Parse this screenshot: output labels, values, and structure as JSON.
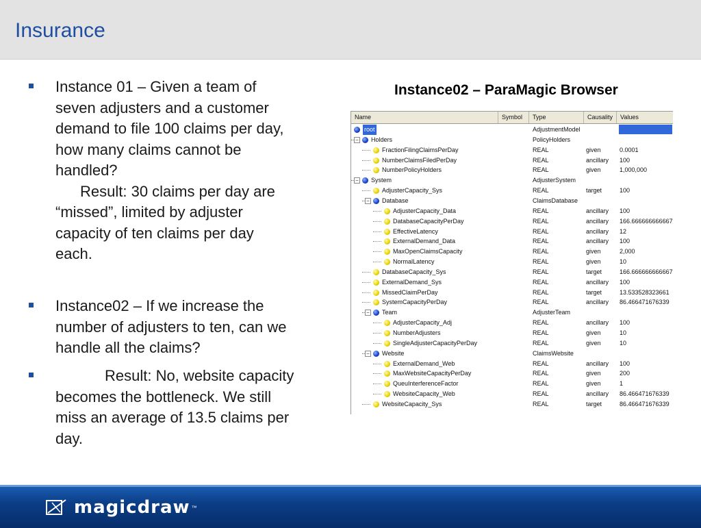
{
  "slide": {
    "title": "Insurance"
  },
  "bullets": [
    {
      "lines": [
        "Instance 01 – Given a team of",
        "seven adjusters and a customer",
        "demand to file 100 claims per day,",
        "how many claims cannot be",
        "handled?"
      ],
      "result_lines": [
        "Result:  30 claims per day are",
        "“missed”, limited by adjuster",
        "capacity of ten claims per day",
        "each."
      ]
    },
    {
      "lines": [
        "Instance02 – If we increase the",
        "number of adjusters to ten, can we",
        "handle all the claims?"
      ]
    },
    {
      "lines": [
        "Result:  No, website capacity",
        "becomes the bottleneck.  We still",
        "miss an average of 13.5 claims per",
        "day."
      ]
    }
  ],
  "browser": {
    "title": "Instance02 – ParaMagic Browser",
    "columns": [
      "Name",
      "Symbol",
      "Type",
      "Causality",
      "Values"
    ],
    "rows": [
      {
        "name": "root",
        "type": "AdjustmentModel",
        "causality": "",
        "value": "",
        "level": 0,
        "kind": "blue",
        "selected": true
      },
      {
        "name": "Holders",
        "type": "PolicyHolders",
        "causality": "",
        "value": "",
        "level": 0,
        "kind": "blue",
        "expander": "−"
      },
      {
        "name": "FractionFilingClaimsPerDay",
        "type": "REAL",
        "causality": "given",
        "value": "0.0001",
        "level": 1,
        "kind": "yellow"
      },
      {
        "name": "NumberClaimsFiledPerDay",
        "type": "REAL",
        "causality": "ancillary",
        "value": "100",
        "level": 1,
        "kind": "yellow"
      },
      {
        "name": "NumberPolicyHolders",
        "type": "REAL",
        "causality": "given",
        "value": "1,000,000",
        "level": 1,
        "kind": "yellow"
      },
      {
        "name": "System",
        "type": "AdjusterSystem",
        "causality": "",
        "value": "",
        "level": 0,
        "kind": "blue",
        "expander": "−"
      },
      {
        "name": "AdjusterCapacity_Sys",
        "type": "REAL",
        "causality": "target",
        "value": "100",
        "level": 1,
        "kind": "yellow"
      },
      {
        "name": "Database",
        "type": "ClaimsDatabase",
        "causality": "",
        "value": "",
        "level": 1,
        "kind": "blue",
        "expander": "−"
      },
      {
        "name": "AdjusterCapacity_Data",
        "type": "REAL",
        "causality": "ancillary",
        "value": "100",
        "level": 2,
        "kind": "yellow"
      },
      {
        "name": "DatabaseCapacityPerDay",
        "type": "REAL",
        "causality": "ancillary",
        "value": "166.666666666667",
        "level": 2,
        "kind": "yellow"
      },
      {
        "name": "EffectiveLatency",
        "type": "REAL",
        "causality": "ancillary",
        "value": "12",
        "level": 2,
        "kind": "yellow"
      },
      {
        "name": "ExternalDemand_Data",
        "type": "REAL",
        "causality": "ancillary",
        "value": "100",
        "level": 2,
        "kind": "yellow"
      },
      {
        "name": "MaxOpenClaimsCapacity",
        "type": "REAL",
        "causality": "given",
        "value": "2,000",
        "level": 2,
        "kind": "yellow"
      },
      {
        "name": "NormalLatency",
        "type": "REAL",
        "causality": "given",
        "value": "10",
        "level": 2,
        "kind": "yellow"
      },
      {
        "name": "DatabaseCapacity_Sys",
        "type": "REAL",
        "causality": "target",
        "value": "166.666666666667",
        "level": 1,
        "kind": "yellow"
      },
      {
        "name": "ExternalDemand_Sys",
        "type": "REAL",
        "causality": "ancillary",
        "value": "100",
        "level": 1,
        "kind": "yellow"
      },
      {
        "name": "MissedClaimPerDay",
        "type": "REAL",
        "causality": "target",
        "value": "13.533528323661",
        "level": 1,
        "kind": "yellow"
      },
      {
        "name": "SystemCapacityPerDay",
        "type": "REAL",
        "causality": "ancillary",
        "value": "86.466471676339",
        "level": 1,
        "kind": "yellow"
      },
      {
        "name": "Team",
        "type": "AdjusterTeam",
        "causality": "",
        "value": "",
        "level": 1,
        "kind": "blue",
        "expander": "−"
      },
      {
        "name": "AdjusterCapacity_Adj",
        "type": "REAL",
        "causality": "ancillary",
        "value": "100",
        "level": 2,
        "kind": "yellow"
      },
      {
        "name": "NumberAdjusters",
        "type": "REAL",
        "causality": "given",
        "value": "10",
        "level": 2,
        "kind": "yellow"
      },
      {
        "name": "SingleAdjusterCapacityPerDay",
        "type": "REAL",
        "causality": "given",
        "value": "10",
        "level": 2,
        "kind": "yellow"
      },
      {
        "name": "Website",
        "type": "ClaimsWebsite",
        "causality": "",
        "value": "",
        "level": 1,
        "kind": "blue",
        "expander": "−"
      },
      {
        "name": "ExternalDemand_Web",
        "type": "REAL",
        "causality": "ancillary",
        "value": "100",
        "level": 2,
        "kind": "yellow"
      },
      {
        "name": "MaxWebsiteCapacityPerDay",
        "type": "REAL",
        "causality": "given",
        "value": "200",
        "level": 2,
        "kind": "yellow"
      },
      {
        "name": "QueuInterferenceFactor",
        "type": "REAL",
        "causality": "given",
        "value": "1",
        "level": 2,
        "kind": "yellow"
      },
      {
        "name": "WebsiteCapacity_Web",
        "type": "REAL",
        "causality": "ancillary",
        "value": "86.466471676339",
        "level": 2,
        "kind": "yellow"
      },
      {
        "name": "WebsiteCapacity_Sys",
        "type": "REAL",
        "causality": "target",
        "value": "86.466471676339",
        "level": 1,
        "kind": "yellow"
      }
    ]
  },
  "footer": {
    "logo_text": "magicdraw",
    "trademark": "™"
  },
  "colors": {
    "title": "#1f4fa1",
    "footer": "#0b3d86",
    "selection": "#3168d9"
  }
}
